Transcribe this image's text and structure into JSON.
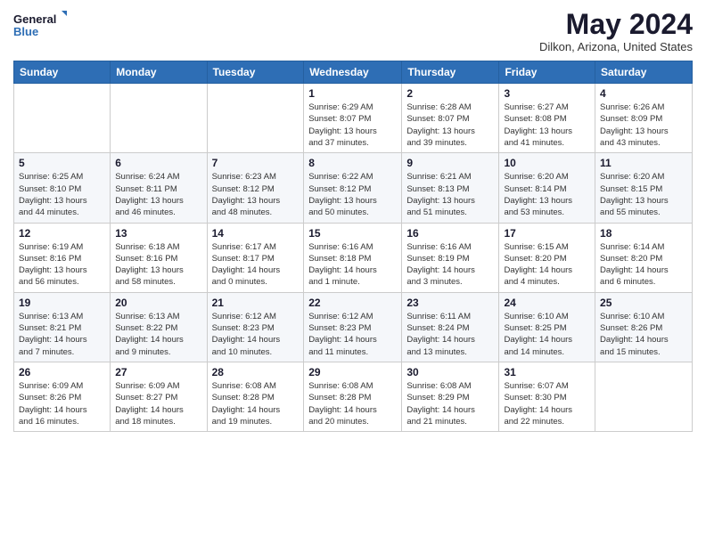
{
  "logo": {
    "line1": "General",
    "line2": "Blue"
  },
  "title": "May 2024",
  "location": "Dilkon, Arizona, United States",
  "days_of_week": [
    "Sunday",
    "Monday",
    "Tuesday",
    "Wednesday",
    "Thursday",
    "Friday",
    "Saturday"
  ],
  "weeks": [
    [
      {
        "day": "",
        "info": ""
      },
      {
        "day": "",
        "info": ""
      },
      {
        "day": "",
        "info": ""
      },
      {
        "day": "1",
        "info": "Sunrise: 6:29 AM\nSunset: 8:07 PM\nDaylight: 13 hours\nand 37 minutes."
      },
      {
        "day": "2",
        "info": "Sunrise: 6:28 AM\nSunset: 8:07 PM\nDaylight: 13 hours\nand 39 minutes."
      },
      {
        "day": "3",
        "info": "Sunrise: 6:27 AM\nSunset: 8:08 PM\nDaylight: 13 hours\nand 41 minutes."
      },
      {
        "day": "4",
        "info": "Sunrise: 6:26 AM\nSunset: 8:09 PM\nDaylight: 13 hours\nand 43 minutes."
      }
    ],
    [
      {
        "day": "5",
        "info": "Sunrise: 6:25 AM\nSunset: 8:10 PM\nDaylight: 13 hours\nand 44 minutes."
      },
      {
        "day": "6",
        "info": "Sunrise: 6:24 AM\nSunset: 8:11 PM\nDaylight: 13 hours\nand 46 minutes."
      },
      {
        "day": "7",
        "info": "Sunrise: 6:23 AM\nSunset: 8:12 PM\nDaylight: 13 hours\nand 48 minutes."
      },
      {
        "day": "8",
        "info": "Sunrise: 6:22 AM\nSunset: 8:12 PM\nDaylight: 13 hours\nand 50 minutes."
      },
      {
        "day": "9",
        "info": "Sunrise: 6:21 AM\nSunset: 8:13 PM\nDaylight: 13 hours\nand 51 minutes."
      },
      {
        "day": "10",
        "info": "Sunrise: 6:20 AM\nSunset: 8:14 PM\nDaylight: 13 hours\nand 53 minutes."
      },
      {
        "day": "11",
        "info": "Sunrise: 6:20 AM\nSunset: 8:15 PM\nDaylight: 13 hours\nand 55 minutes."
      }
    ],
    [
      {
        "day": "12",
        "info": "Sunrise: 6:19 AM\nSunset: 8:16 PM\nDaylight: 13 hours\nand 56 minutes."
      },
      {
        "day": "13",
        "info": "Sunrise: 6:18 AM\nSunset: 8:16 PM\nDaylight: 13 hours\nand 58 minutes."
      },
      {
        "day": "14",
        "info": "Sunrise: 6:17 AM\nSunset: 8:17 PM\nDaylight: 14 hours\nand 0 minutes."
      },
      {
        "day": "15",
        "info": "Sunrise: 6:16 AM\nSunset: 8:18 PM\nDaylight: 14 hours\nand 1 minute."
      },
      {
        "day": "16",
        "info": "Sunrise: 6:16 AM\nSunset: 8:19 PM\nDaylight: 14 hours\nand 3 minutes."
      },
      {
        "day": "17",
        "info": "Sunrise: 6:15 AM\nSunset: 8:20 PM\nDaylight: 14 hours\nand 4 minutes."
      },
      {
        "day": "18",
        "info": "Sunrise: 6:14 AM\nSunset: 8:20 PM\nDaylight: 14 hours\nand 6 minutes."
      }
    ],
    [
      {
        "day": "19",
        "info": "Sunrise: 6:13 AM\nSunset: 8:21 PM\nDaylight: 14 hours\nand 7 minutes."
      },
      {
        "day": "20",
        "info": "Sunrise: 6:13 AM\nSunset: 8:22 PM\nDaylight: 14 hours\nand 9 minutes."
      },
      {
        "day": "21",
        "info": "Sunrise: 6:12 AM\nSunset: 8:23 PM\nDaylight: 14 hours\nand 10 minutes."
      },
      {
        "day": "22",
        "info": "Sunrise: 6:12 AM\nSunset: 8:23 PM\nDaylight: 14 hours\nand 11 minutes."
      },
      {
        "day": "23",
        "info": "Sunrise: 6:11 AM\nSunset: 8:24 PM\nDaylight: 14 hours\nand 13 minutes."
      },
      {
        "day": "24",
        "info": "Sunrise: 6:10 AM\nSunset: 8:25 PM\nDaylight: 14 hours\nand 14 minutes."
      },
      {
        "day": "25",
        "info": "Sunrise: 6:10 AM\nSunset: 8:26 PM\nDaylight: 14 hours\nand 15 minutes."
      }
    ],
    [
      {
        "day": "26",
        "info": "Sunrise: 6:09 AM\nSunset: 8:26 PM\nDaylight: 14 hours\nand 16 minutes."
      },
      {
        "day": "27",
        "info": "Sunrise: 6:09 AM\nSunset: 8:27 PM\nDaylight: 14 hours\nand 18 minutes."
      },
      {
        "day": "28",
        "info": "Sunrise: 6:08 AM\nSunset: 8:28 PM\nDaylight: 14 hours\nand 19 minutes."
      },
      {
        "day": "29",
        "info": "Sunrise: 6:08 AM\nSunset: 8:28 PM\nDaylight: 14 hours\nand 20 minutes."
      },
      {
        "day": "30",
        "info": "Sunrise: 6:08 AM\nSunset: 8:29 PM\nDaylight: 14 hours\nand 21 minutes."
      },
      {
        "day": "31",
        "info": "Sunrise: 6:07 AM\nSunset: 8:30 PM\nDaylight: 14 hours\nand 22 minutes."
      },
      {
        "day": "",
        "info": ""
      }
    ]
  ]
}
